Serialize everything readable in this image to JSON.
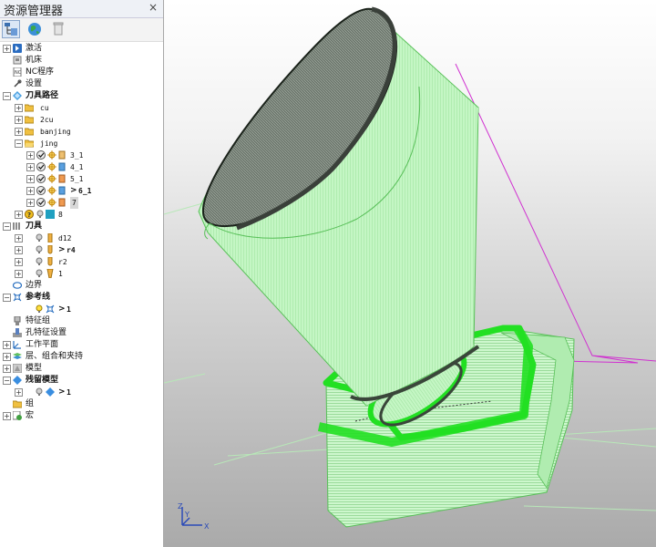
{
  "explorer": {
    "title": "资源管理器",
    "close_glyph": "×",
    "toolbar": {
      "tree_icon": "tree-view-icon",
      "globe_icon": "globe-icon",
      "trash_icon": "trash-icon"
    },
    "items": {
      "activate": "激活",
      "machine": "机床",
      "nc_program": "NC程序",
      "settings": "设置",
      "toolpaths": "刀具路径",
      "tp_cu": "cu",
      "tp_2cu": "2cu",
      "tp_banjing": "banjing",
      "tp_jing": "jing",
      "jing_1": "3_1",
      "jing_2": "4_1",
      "jing_3": "5_1",
      "jing_4_prefix": ">",
      "jing_4": "6_1",
      "jing_5_badge": "7",
      "tp_8": "8",
      "tools": "刀具",
      "tool_1": "d12",
      "tool_2_prefix": ">",
      "tool_2": "r4",
      "tool_3": "r2",
      "tool_4": "1",
      "boundary": "边界",
      "reference_curves": "参考线",
      "ref_1_prefix": ">",
      "ref_1": "1",
      "feature_groups": "特征组",
      "hole_feature_settings": "孔特征设置",
      "workplanes": "工作平面",
      "layers": "层、组合和夹持",
      "models": "模型",
      "stock_models": "残留模型",
      "stock_1_prefix": ">",
      "stock_1": "1",
      "groups": "组",
      "macros": "宏"
    }
  },
  "viewport": {
    "triad_labels": {
      "z": "Z",
      "y": "Y",
      "x": "X"
    },
    "colors": {
      "shell": "#c2f5c2",
      "shell_edge": "#58c058",
      "dark_band": "#4a5a4a",
      "bright_green": "#22e022",
      "outline_magenta": "#d030d0",
      "bg_top": "#ffffff",
      "bg_bottom": "#aaaaaa"
    }
  }
}
